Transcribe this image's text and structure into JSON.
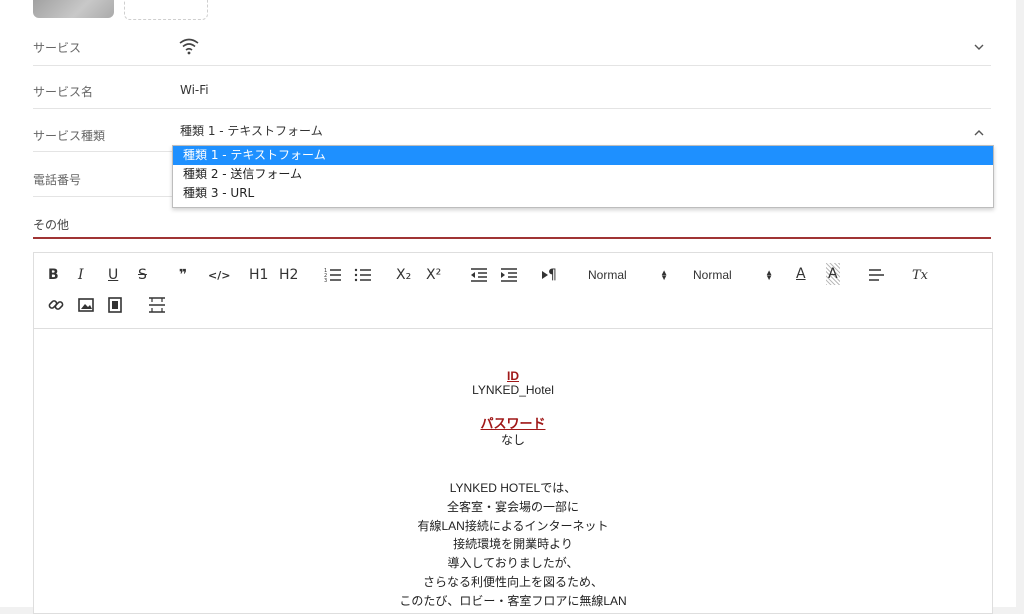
{
  "form": {
    "service": {
      "label": "サービス",
      "icon": "wifi-icon"
    },
    "service_name": {
      "label": "サービス名",
      "value": "Wi-Fi"
    },
    "service_type": {
      "label": "サービス種類",
      "value": "種類 1 - テキストフォーム",
      "options": [
        "種類 1 - テキストフォーム",
        "種類 2 - 送信フォーム",
        "種類 3 - URL"
      ],
      "selected_index": 0
    },
    "phone": {
      "label": "電話番号"
    },
    "other": {
      "label": "その他"
    }
  },
  "toolbar": {
    "bold": "B",
    "italic": "I",
    "underline": "U",
    "strike": "S",
    "quote": "❞",
    "code": "</>",
    "h1": "H1",
    "h2": "H2",
    "subscript": "X₂",
    "superscript": "X²",
    "direction": "¶",
    "font_select": "Normal",
    "size_select": "Normal",
    "color": "A",
    "background": "A",
    "align": "≡",
    "clean": "Tx"
  },
  "content": {
    "id_heading": "ID",
    "id_value": "LYNKED_Hotel",
    "pw_heading": "パスワード",
    "pw_value": "なし",
    "paragraph": [
      "LYNKED HOTELでは、",
      "全客室・宴会場の一部に",
      "有線LAN接続によるインターネット",
      "接続環境を開業時より",
      "導入しておりましたが、",
      "さらなる利便性向上を図るため、",
      "このたび、ロビー・客室フロアに無線LAN"
    ]
  },
  "colors": {
    "accent_selected": "#1e90ff",
    "field_underline": "#a03434",
    "heading_red": "#a01818"
  }
}
